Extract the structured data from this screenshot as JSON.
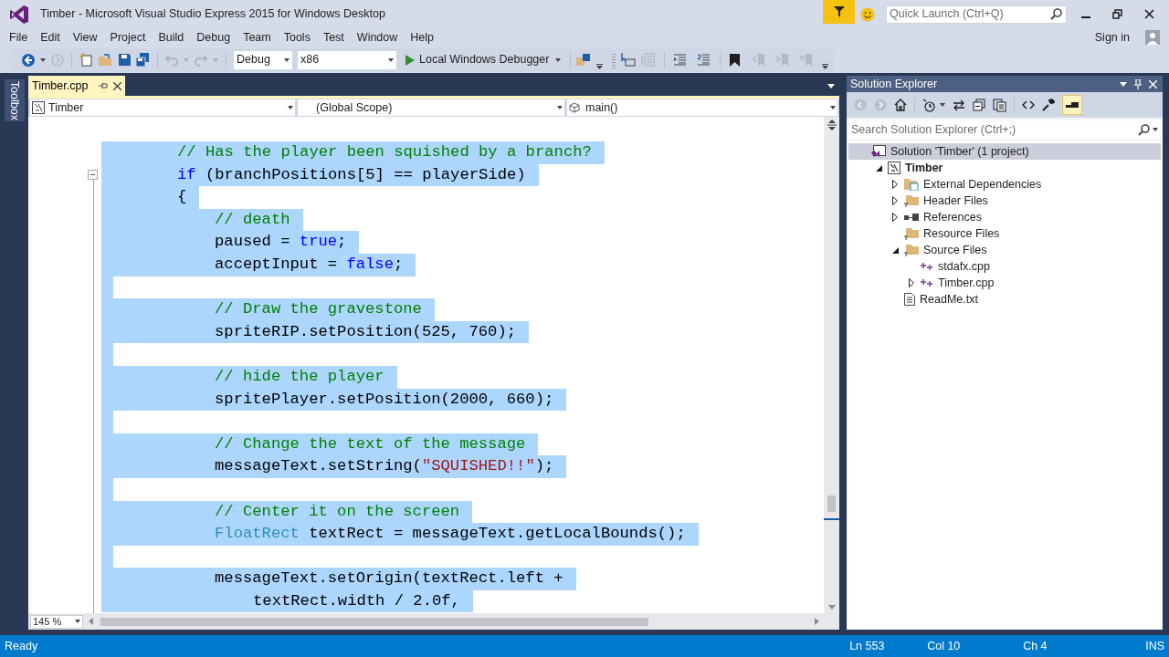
{
  "window": {
    "title": "Timber - Microsoft Visual Studio Express 2015 for Windows Desktop"
  },
  "quick_launch": {
    "placeholder": "Quick Launch (Ctrl+Q)"
  },
  "menu": [
    "File",
    "Edit",
    "View",
    "Project",
    "Build",
    "Debug",
    "Team",
    "Tools",
    "Test",
    "Window",
    "Help"
  ],
  "sign_in": "Sign in",
  "toolbar": {
    "configuration": "Debug",
    "platform": "x86",
    "start_button": "Local Windows Debugger"
  },
  "toolbox": "Toolbox",
  "editor": {
    "tabs": [
      {
        "label": "Timber.cpp",
        "selected": true
      }
    ],
    "navigation": {
      "project": "Timber",
      "scope": "(Global Scope)",
      "member": "main()"
    },
    "lines": [
      {
        "selected": true,
        "kind": "outer",
        "tokens": [
          {
            "kind": "comment",
            "text": "// Has the player been squished by a branch?"
          }
        ]
      },
      {
        "selected": true,
        "kind": "outer",
        "collapsible": true,
        "tokens": [
          {
            "kind": "keyword",
            "text": "if"
          },
          {
            "kind": "plain",
            "text": " (branchPositions[5] == playerSide)"
          }
        ]
      },
      {
        "selected": true,
        "kind": "outer",
        "tokens": [
          {
            "kind": "plain",
            "text": "{"
          }
        ]
      },
      {
        "selected": true,
        "kind": "inner",
        "tokens": [
          {
            "kind": "comment",
            "text": "// death"
          }
        ]
      },
      {
        "selected": true,
        "kind": "inner",
        "tokens": [
          {
            "kind": "plain",
            "text": "paused = "
          },
          {
            "kind": "keyword",
            "text": "true"
          },
          {
            "kind": "plain",
            "text": ";"
          }
        ]
      },
      {
        "selected": true,
        "kind": "inner",
        "tokens": [
          {
            "kind": "plain",
            "text": "acceptInput = "
          },
          {
            "kind": "keyword",
            "text": "false"
          },
          {
            "kind": "plain",
            "text": ";"
          }
        ]
      },
      {
        "selected": true
      },
      {
        "selected": true,
        "kind": "inner",
        "tokens": [
          {
            "kind": "comment",
            "text": "// Draw the gravestone"
          }
        ]
      },
      {
        "selected": true,
        "kind": "inner",
        "tokens": [
          {
            "kind": "plain",
            "text": "spriteRIP.setPosition(525, 760);"
          }
        ]
      },
      {
        "selected": true
      },
      {
        "selected": true,
        "kind": "inner",
        "tokens": [
          {
            "kind": "comment",
            "text": "// hide the player"
          }
        ]
      },
      {
        "selected": true,
        "kind": "inner",
        "tokens": [
          {
            "kind": "plain",
            "text": "spritePlayer.setPosition(2000, 660);"
          }
        ]
      },
      {
        "selected": true
      },
      {
        "selected": true,
        "kind": "inner",
        "tokens": [
          {
            "kind": "comment",
            "text": "// Change the text of the message"
          }
        ]
      },
      {
        "selected": true,
        "kind": "inner",
        "tokens": [
          {
            "kind": "plain",
            "text": "messageText.setString("
          },
          {
            "kind": "string",
            "text": "\"SQUISHED!!\""
          },
          {
            "kind": "plain",
            "text": ");"
          }
        ]
      },
      {
        "selected": true
      },
      {
        "selected": true,
        "kind": "inner",
        "tokens": [
          {
            "kind": "comment",
            "text": "// Center it on the screen"
          }
        ]
      },
      {
        "selected": true,
        "kind": "inner",
        "tokens": [
          {
            "kind": "type",
            "text": "FloatRect"
          },
          {
            "kind": "plain",
            "text": " textRect = messageText.getLocalBounds();"
          }
        ]
      },
      {
        "selected": true
      },
      {
        "selected": true,
        "kind": "inner",
        "tokens": [
          {
            "kind": "plain",
            "text": "messageText.setOrigin(textRect.left +"
          }
        ]
      },
      {
        "selected": true,
        "kind": "continued",
        "tokens": [
          {
            "kind": "plain",
            "text": "textRect.width / 2.0f,"
          }
        ]
      }
    ],
    "zoom": "145 %"
  },
  "solution_explorer": {
    "title": "Solution Explorer",
    "search": {
      "placeholder": "Search Solution Explorer (Ctrl+;)"
    },
    "items": [
      {
        "label": "Solution 'Timber' (1 project)",
        "kind": "solution",
        "selected": true,
        "children": [
          {
            "label": "Timber",
            "kind": "project",
            "selected": false,
            "expanded": true,
            "children": [
              {
                "label": "External Dependencies",
                "kind": "external",
                "selected": false,
                "expanded": false
              },
              {
                "label": "Header Files",
                "kind": "folder",
                "selected": false,
                "expanded": false
              },
              {
                "label": "References",
                "kind": "references",
                "selected": false,
                "expanded": false
              },
              {
                "label": "Resource Files",
                "kind": "folder",
                "selected": false
              },
              {
                "label": "Source Files",
                "kind": "folder",
                "selected": false,
                "expanded": true,
                "children": [
                  {
                    "label": "stdafx.cpp",
                    "kind": "cpp",
                    "selected": false
                  },
                  {
                    "label": "Timber.cpp",
                    "kind": "cpp",
                    "selected": false,
                    "expanded": false
                  }
                ]
              },
              {
                "label": "ReadMe.txt",
                "kind": "text",
                "selected": false
              }
            ]
          }
        ]
      }
    ]
  },
  "status_bar": {
    "message": "Ready",
    "line": "Ln 553",
    "column": "Col 10",
    "char": "Ch 4",
    "mode": "INS"
  }
}
